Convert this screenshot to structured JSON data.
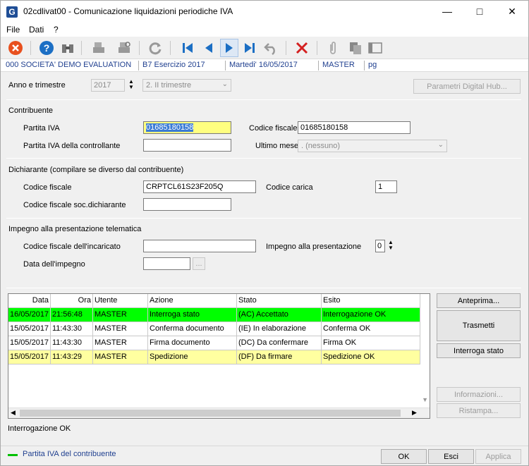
{
  "window": {
    "title": "02cdlivat00 - Comunicazione liquidazioni periodiche IVA",
    "icon_letter": "G"
  },
  "menu": [
    "File",
    "Dati",
    "?"
  ],
  "toolbar_icons": [
    "close-circle-icon",
    "help-icon",
    "binoculars-icon",
    "print-icon",
    "print-preview-icon",
    "refresh-icon",
    "first-record-icon",
    "previous-record-icon",
    "next-record-icon",
    "last-record-icon",
    "undo-icon",
    "delete-icon",
    "attach-icon",
    "copy-icon",
    "layout-icon"
  ],
  "status": {
    "company": "000 SOCIETA' DEMO EVALUATION",
    "year": "B7 Esercizio 2017",
    "date": "Martedi' 16/05/2017",
    "user": "MASTER",
    "profile": "pg"
  },
  "anno": {
    "label": "Anno e trimestre",
    "year": "2017",
    "quarter": "2. II trimestre",
    "digital_hub": "Parametri Digital Hub..."
  },
  "contribuente": {
    "heading": "Contribuente",
    "piva_label": "Partita IVA",
    "piva": "01685180158",
    "cf_label": "Codice fiscale",
    "cf": "01685180158",
    "piva_controllante_label": "Partita IVA della controllante",
    "piva_controllante": "",
    "ultimo_mese_label": "Ultimo mese",
    "ultimo_mese": ". (nessuno)"
  },
  "dichiarante": {
    "heading": "Dichiarante (compilare se diverso dal contribuente)",
    "cf_label": "Codice fiscale",
    "cf": "CRPTCL61S23F205Q",
    "carica_label": "Codice carica",
    "carica": "1",
    "cf_soc_label": "Codice fiscale soc.dichiarante",
    "cf_soc": ""
  },
  "impegno": {
    "heading": "Impegno alla presentazione telematica",
    "cf_incaricato_label": "Codice fiscale dell'incaricato",
    "cf_incaricato": "",
    "impegno_label": "Impegno alla presentazione",
    "impegno": "0",
    "data_label": "Data dell'impegno",
    "data": "",
    "date_btn": "..."
  },
  "grid": {
    "columns": [
      "Data",
      "Ora",
      "Utente",
      "Azione",
      "Stato",
      "Esito"
    ],
    "rows": [
      [
        "16/05/2017",
        "21:56:48",
        "MASTER",
        "Interroga stato",
        "(AC) Accettato",
        "Interrogazione OK"
      ],
      [
        "15/05/2017",
        "11:43:30",
        "MASTER",
        "Conferma documento",
        "(IE) In elaborazione",
        "Conferma OK"
      ],
      [
        "15/05/2017",
        "11:43:30",
        "MASTER",
        "Firma documento",
        "(DC) Da confermare",
        "Firma OK"
      ],
      [
        "15/05/2017",
        "11:43:29",
        "MASTER",
        "Spedizione",
        "(DF) Da firmare",
        "Spedizione OK"
      ]
    ],
    "row_colors": [
      "#00ff00",
      "#ffffff",
      "#ffffff",
      "#ffffa0"
    ]
  },
  "side_buttons": {
    "anteprima": "Anteprima...",
    "trasmetti": "Trasmetti",
    "interroga": "Interroga stato",
    "informazioni": "Informazioni...",
    "ristampa": "Ristampa..."
  },
  "result_text": "Interrogazione OK",
  "footer": {
    "legend": "Partita IVA del contribuente",
    "legend_color": "#00c000",
    "ok": "OK",
    "esci": "Esci",
    "applica": "Applica"
  }
}
